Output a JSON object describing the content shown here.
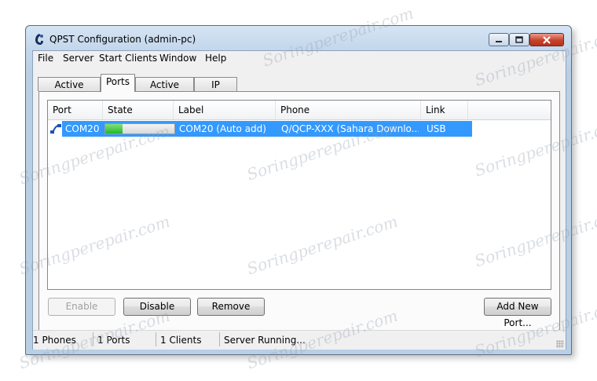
{
  "window": {
    "title": "QPST Configuration (admin-pc)",
    "controls": {
      "minimize": "▭",
      "maximize": "□",
      "close": "✕"
    }
  },
  "menu": [
    "File",
    "Server",
    "Start Clients",
    "Window",
    "Help"
  ],
  "tabs": [
    "Active Phones",
    "Ports",
    "Active Clients",
    "IP Server"
  ],
  "active_tab": "Ports",
  "table": {
    "columns": [
      "Port",
      "State",
      "Label",
      "Phone",
      "Link"
    ],
    "rows": [
      {
        "port": "COM20",
        "state_progress": 0.25,
        "label": "COM20 (Auto add)",
        "phone": "Q/QCP-XXX (Sahara Downlo...",
        "link": "USB"
      }
    ]
  },
  "buttons": {
    "enable": "Enable",
    "disable": "Disable",
    "remove": "Remove",
    "add_new_port": "Add New Port..."
  },
  "status": {
    "phones": "1 Phones",
    "ports": "1 Ports",
    "clients": "1 Clients",
    "server": "Server Running..."
  },
  "watermark": "Soringperepair.com",
  "colors": {
    "selection": "#3399ff",
    "progress": "#27b527"
  }
}
